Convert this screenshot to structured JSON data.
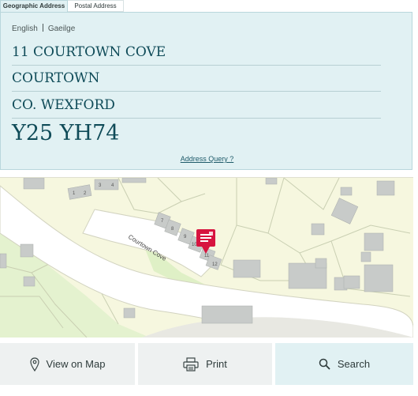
{
  "tabs": [
    {
      "label": "Geographic Address",
      "active": true
    },
    {
      "label": "Postal Address",
      "active": false
    }
  ],
  "language": {
    "english": "English",
    "irish": "Gaeilge"
  },
  "address": {
    "line1": "11 COURTOWN COVE",
    "line2": "COURTOWN",
    "line3": "CO. WEXFORD",
    "eircode": "Y25 YH74"
  },
  "address_query_link": "Address Query ?",
  "map": {
    "road_label": "Courtown Cove",
    "building_numbers": [
      "1",
      "2",
      "3",
      "4",
      "7",
      "8",
      "9",
      "10",
      "11",
      "12"
    ],
    "marker_icon": "mailbox-pin-icon",
    "marker_color": "#d7143f"
  },
  "actions": {
    "view_on_map": "View on Map",
    "print": "Print",
    "search": "Search"
  },
  "colors": {
    "panel_bg": "#e1f1f3",
    "text_accent": "#0f4b58",
    "map_bg": "#f6f7df"
  }
}
